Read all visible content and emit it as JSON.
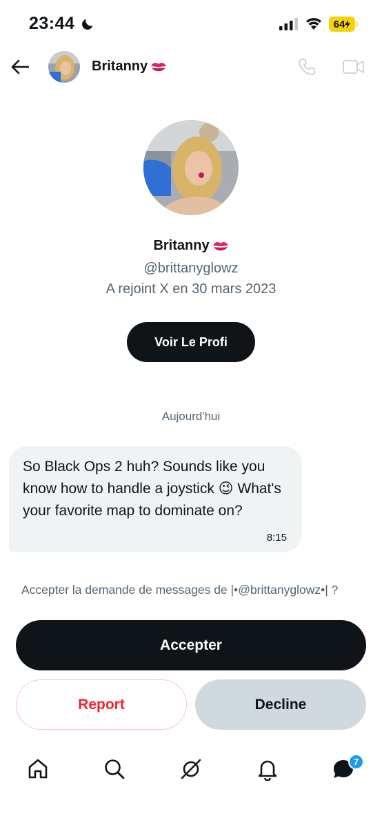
{
  "status_bar": {
    "time": "23:44",
    "battery": "64",
    "battery_color": "#f5d10a"
  },
  "header": {
    "name": "Britanny",
    "name_emoji": "kiss-mark-icon",
    "icons": [
      "back-arrow-icon",
      "phone-icon",
      "video-camera-icon"
    ]
  },
  "profile": {
    "name": "Britanny",
    "handle": "@brittanyglowz",
    "joined": "A rejoint X en 30 mars 2023",
    "view_profile_label": "Voir Le Profi"
  },
  "conversation": {
    "date_separator": "Aujourd'hui",
    "messages": [
      {
        "text": "So Black Ops 2 huh? Sounds like you know how to handle a joystick 😉 What's your favorite map to dominate on?",
        "time": "8:15"
      }
    ]
  },
  "request": {
    "prompt": "Accepter la demande de messages de |•@brittanyglowz•| ?",
    "accept_label": "Accepter",
    "report_label": "Report",
    "decline_label": "Decline"
  },
  "tabbar": {
    "items": [
      "home-icon",
      "search-icon",
      "grok-icon",
      "bell-icon",
      "messages-icon"
    ],
    "messages_badge": "7",
    "badge_color": "#1d9bf0"
  },
  "colors": {
    "primary_dark": "#0f1419",
    "secondary_text": "#536471",
    "danger": "#f4212e",
    "bubble": "#eff3f4"
  }
}
